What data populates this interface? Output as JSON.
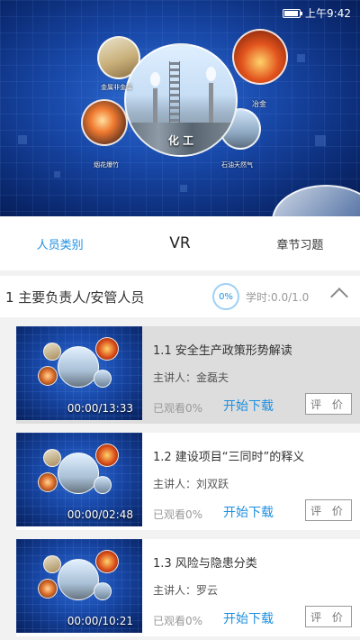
{
  "status_bar": {
    "time": "上午9:42"
  },
  "banner": {
    "main_caption": "化 工",
    "labels": [
      "金属非金属",
      "冶金",
      "烟花爆竹",
      "石油天然气"
    ]
  },
  "tabs": [
    {
      "label": "人员类别",
      "active": true
    },
    {
      "label": "VR",
      "active": false
    },
    {
      "label": "章节习题",
      "active": false
    }
  ],
  "section": {
    "title": "1 主要负责人/安管人员",
    "progress": "0%",
    "study_time": "学时:0.0/1.0"
  },
  "courses": [
    {
      "title": "1.1 安全生产政策形势解读",
      "lecturer": "主讲人：金磊夫",
      "watched": "已观看0%",
      "download": "开始下载",
      "rate": "评 价",
      "duration": "00:00/13:33"
    },
    {
      "title": "1.2 建设项目“三同时”的释义",
      "lecturer": "主讲人：刘双跃",
      "watched": "已观看0%",
      "download": "开始下载",
      "rate": "评 价",
      "duration": "00:00/02:48"
    },
    {
      "title": "1.3 风险与隐患分类",
      "lecturer": "主讲人：罗云",
      "watched": "已观看0%",
      "download": "开始下载",
      "rate": "评 价",
      "duration": "00:00/10:21"
    }
  ],
  "colors": {
    "accent": "#1e8fe0"
  }
}
